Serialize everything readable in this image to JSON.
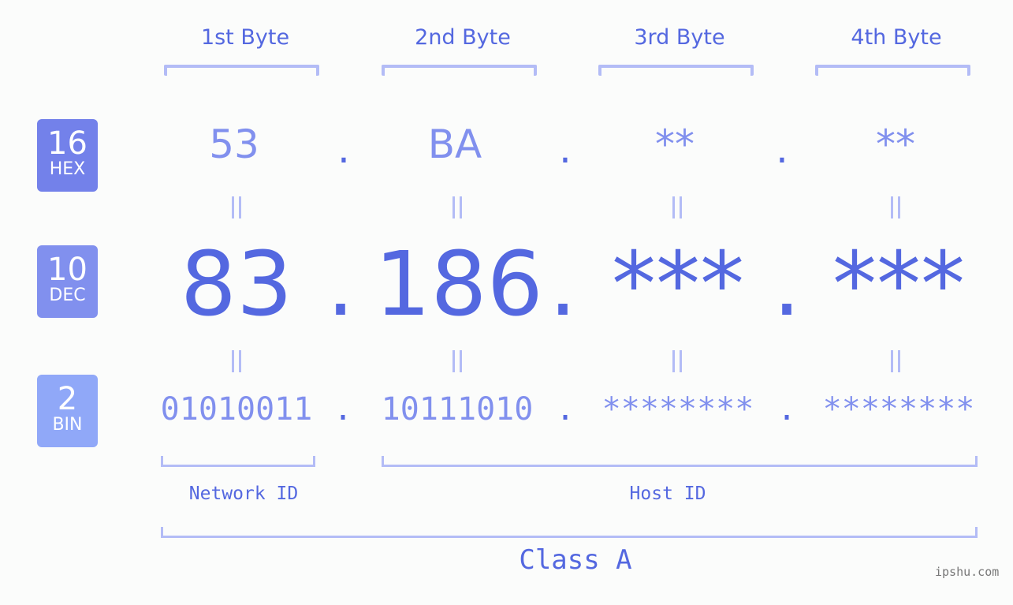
{
  "byte_headers": [
    "1st Byte",
    "2nd Byte",
    "3rd Byte",
    "4th Byte"
  ],
  "badges": {
    "hex": {
      "number": "16",
      "label": "HEX",
      "color": "#7381ea"
    },
    "dec": {
      "number": "10",
      "label": "DEC",
      "color": "#8190ee"
    },
    "bin": {
      "number": "2",
      "label": "BIN",
      "color": "#90a8f8"
    }
  },
  "hex": [
    "53",
    "BA",
    "**",
    "**"
  ],
  "dec": [
    "83",
    "186",
    "***",
    "***"
  ],
  "bin": [
    "01010011",
    "10111010",
    "********",
    "********"
  ],
  "separator": ".",
  "network_id_label": "Network ID",
  "host_id_label": "Host ID",
  "class_label": "Class A",
  "watermark": "ipshu.com",
  "colors": {
    "primary": "#5468e0",
    "secondary": "#8190ee",
    "bracket": "#b3bcf6",
    "background": "#fbfcfb"
  }
}
